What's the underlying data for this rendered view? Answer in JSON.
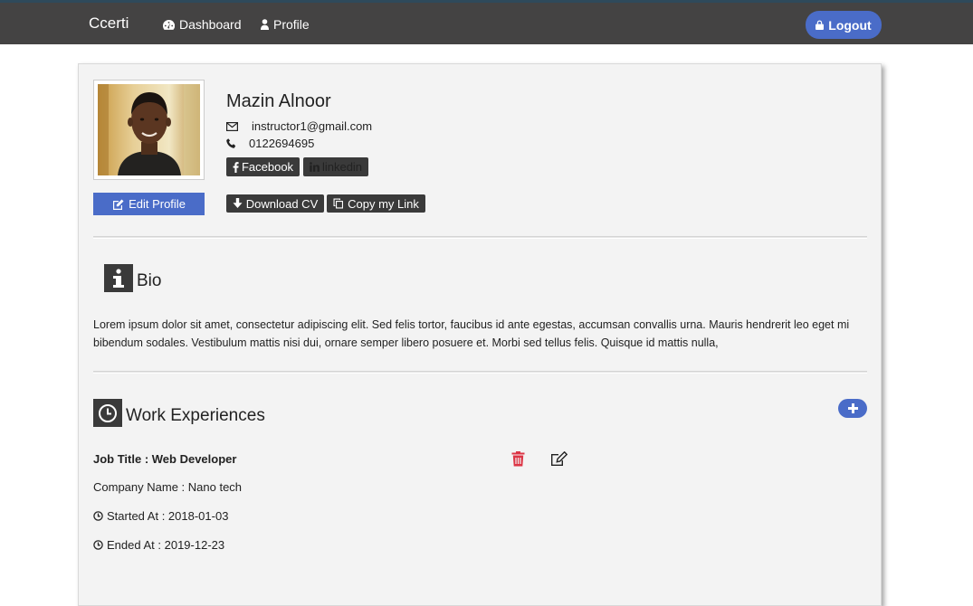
{
  "navbar": {
    "brand": "Ccerti",
    "links": [
      {
        "label": "Dashboard",
        "icon": "dashboard-icon"
      },
      {
        "label": "Profile",
        "icon": "user-icon"
      }
    ],
    "logout_label": "Logout",
    "logout_icon": "lock-icon",
    "accent_color": "#4a6cc8"
  },
  "profile": {
    "name": "Mazin Alnoor",
    "email": "instructor1@gmail.com",
    "phone": "0122694695",
    "facebook_label": "Facebook",
    "linkedin_label": "linkedin",
    "edit_profile_label": "Edit Profile",
    "download_cv_label": "Download CV",
    "copy_link_label": "Copy my Link"
  },
  "bio": {
    "title": "Bio",
    "text": "Lorem ipsum dolor sit amet, consectetur adipiscing elit. Sed felis tortor, faucibus id ante egestas, accumsan convallis urna. Mauris hendrerit leo eget mi bibendum sodales. Vestibulum mattis nisi dui, ornare semper libero posuere et. Morbi sed tellus felis. Quisque id mattis nulla,"
  },
  "work": {
    "title": "Work Experiences",
    "entries": [
      {
        "job_title": "Job Title : Web Developer",
        "company": "Company Name : Nano tech",
        "started": "Started At : 2018-01-03",
        "ended": "Ended At : 2019-12-23"
      }
    ]
  }
}
